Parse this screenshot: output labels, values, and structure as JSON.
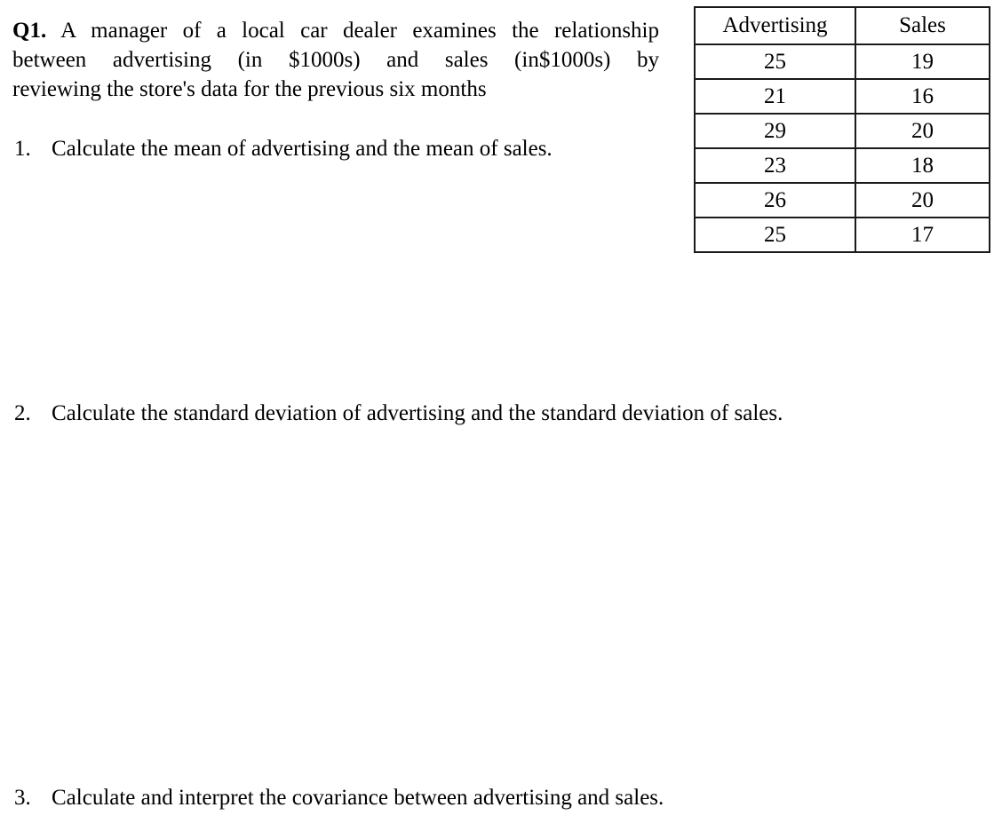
{
  "question": {
    "label": "Q1.",
    "intro_lines": [
      "A manager of a local car dealer examines the relationship",
      "between advertising (in $1000s) and sales (in$1000s) by",
      "reviewing the store's data for the previous six months"
    ],
    "intro_full": "Q1. A manager of a local car dealer examines the relationship between advertising (in $1000s) and sales (in$1000s) by reviewing the store's data for the previous six months"
  },
  "items": [
    {
      "number": "1.",
      "text": "Calculate the mean of advertising and the mean of sales."
    },
    {
      "number": "2.",
      "text": "Calculate the standard deviation of advertising and the standard deviation of sales."
    },
    {
      "number": "3.",
      "text": "Calculate and interpret the covariance between advertising and sales."
    }
  ],
  "table": {
    "headers": [
      "Advertising",
      "Sales"
    ],
    "rows": [
      [
        "25",
        "19"
      ],
      [
        "21",
        "16"
      ],
      [
        "29",
        "20"
      ],
      [
        "23",
        "18"
      ],
      [
        "26",
        "20"
      ],
      [
        "25",
        "17"
      ]
    ]
  },
  "colors": {
    "page_background": "#ffffff",
    "text": "#000000",
    "table_border": "#1a1a1a"
  }
}
